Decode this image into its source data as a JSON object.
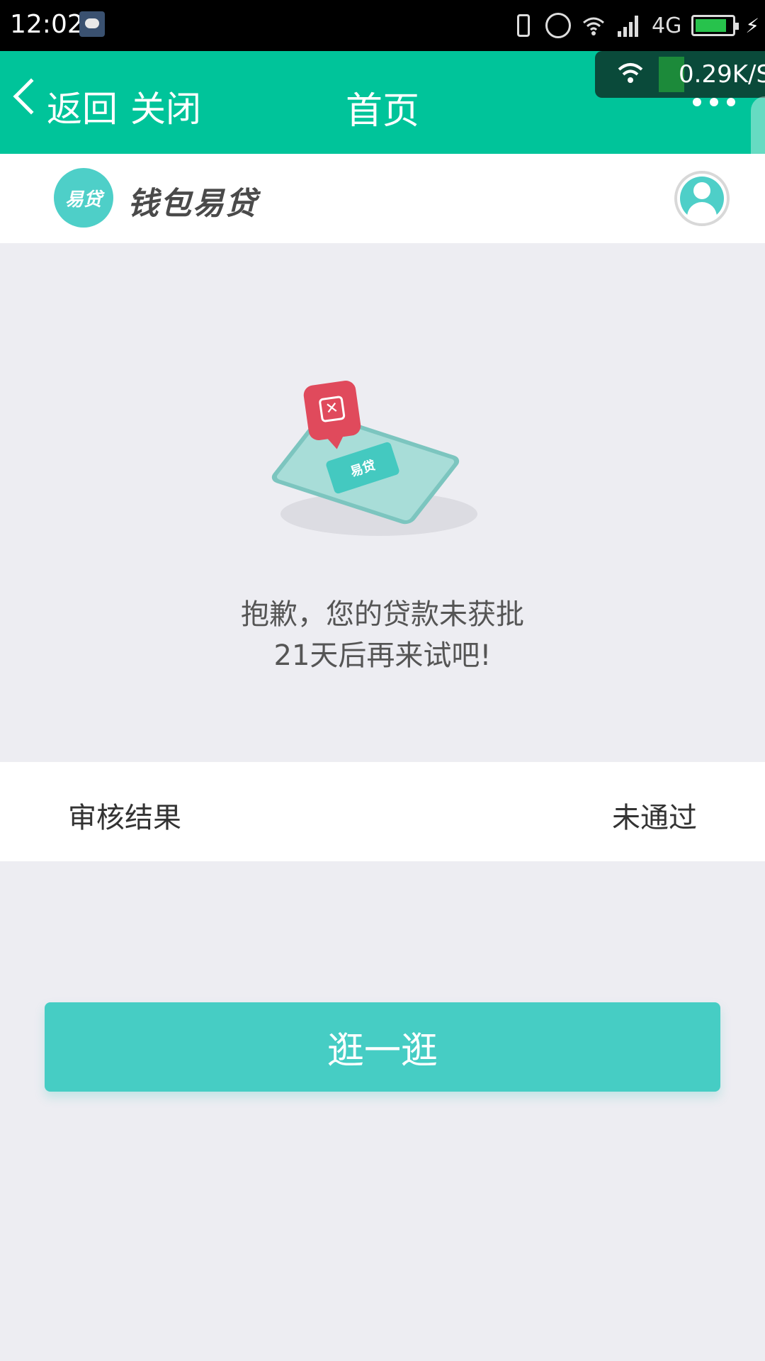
{
  "status_bar": {
    "time": "12:02",
    "network": "4G",
    "battery_level": 0.85,
    "icons": [
      "wechat-icon",
      "vibrate-icon",
      "alarm-icon",
      "wifi-icon",
      "signal-icon",
      "battery-icon",
      "charging-icon"
    ]
  },
  "header": {
    "back_label": "返回",
    "close_label": "关闭",
    "title": "首页",
    "speed": "0.29K/S",
    "accent_color": "#00c49a"
  },
  "brand": {
    "logo_text": "易贷",
    "name": "钱包易贷"
  },
  "illustration": {
    "phone_badge": "易贷"
  },
  "message": {
    "line1": "抱歉，您的贷款未获批",
    "line2": "21天后再来试吧!"
  },
  "result": {
    "label": "审核结果",
    "value": "未通过"
  },
  "action": {
    "button_label": "逛一逛",
    "button_color": "#46cdc4"
  }
}
